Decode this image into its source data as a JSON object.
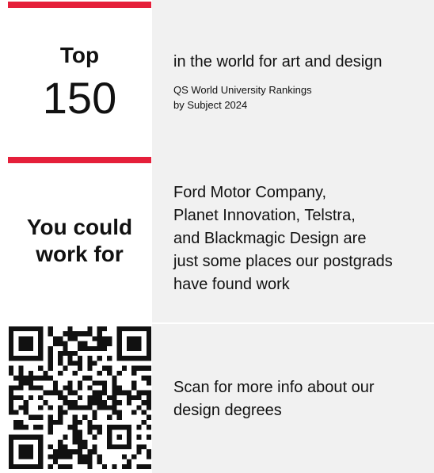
{
  "accent_color": "#e51f3a",
  "ranking": {
    "top_label": "Top",
    "top_number": "150",
    "headline": "in the world for art and design",
    "source_line1": "QS World University Rankings",
    "source_line2": "by Subject 2024"
  },
  "employers": {
    "label_line1": "You could",
    "label_line2": "work for",
    "text_lines": [
      "Ford Motor Company,",
      "Planet Innovation, Telstra,",
      "and Blackmagic Design are",
      "just some places our postgrads",
      "have found work"
    ]
  },
  "scan": {
    "qr_icon": "qr-code-icon",
    "text_lines": [
      "Scan for more info about our",
      "design degrees"
    ]
  }
}
